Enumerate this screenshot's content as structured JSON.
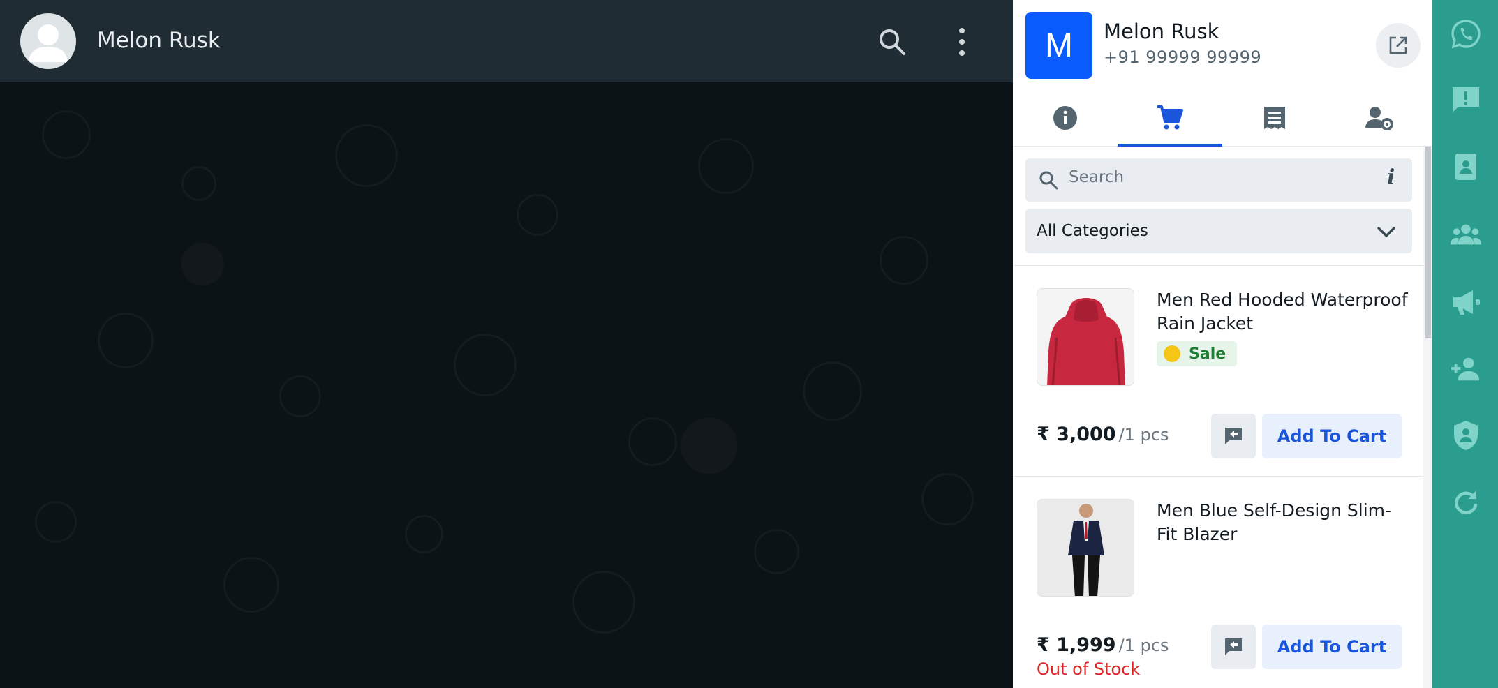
{
  "chat": {
    "contact_name": "Melon Rusk"
  },
  "panel": {
    "avatar_letter": "M",
    "contact_name": "Melon Rusk",
    "contact_phone": "+91 99999 99999",
    "active_tab": "catalog",
    "search_placeholder": "Search",
    "info_symbol": "i",
    "category": "All Categories",
    "products": [
      {
        "title": "Men Red Hooded Waterproof Rain Jacket",
        "badge": "Sale",
        "price": "₹ 3,000",
        "unit": "/1 pcs",
        "stock_status": "",
        "cart_label": "Add To Cart"
      },
      {
        "title": "Men Blue Self-Design Slim-Fit Blazer",
        "badge": "",
        "price": "₹ 1,999",
        "unit": "/1 pcs",
        "stock_status": "Out of Stock",
        "cart_label": "Add To Cart"
      }
    ]
  },
  "rail_icons": [
    "whatsapp-icon",
    "report-icon",
    "contact-book-icon",
    "groups-icon",
    "megaphone-icon",
    "add-person-icon",
    "shield-icon",
    "refresh-icon"
  ],
  "colors": {
    "accent": "#1a56db",
    "avatar": "#0a5cff",
    "rail": "#2a9d8f",
    "chat_header": "#202c33",
    "sale": "#1e7d32",
    "out_of_stock": "#e02424"
  }
}
